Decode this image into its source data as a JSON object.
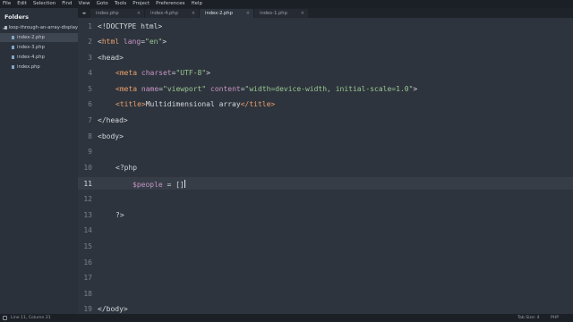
{
  "menubar": {
    "items": [
      "File",
      "Edit",
      "Selection",
      "Find",
      "View",
      "Goto",
      "Tools",
      "Project",
      "Preferences",
      "Help"
    ]
  },
  "sidebar": {
    "title": "Folders",
    "folder": "loop-through-an-array-display",
    "files": [
      {
        "name": "index-2.php",
        "active": true
      },
      {
        "name": "index-3.php",
        "active": false
      },
      {
        "name": "index-4.php",
        "active": false
      },
      {
        "name": "index.php",
        "active": false
      }
    ]
  },
  "tabs": [
    {
      "label": "index.php",
      "active": false
    },
    {
      "label": "index-4.php",
      "active": false
    },
    {
      "label": "index-2.php",
      "active": true
    },
    {
      "label": "index-1.php",
      "active": false
    }
  ],
  "editor": {
    "current_line": 11,
    "line_numbers": [
      "1",
      "2",
      "3",
      "4",
      "5",
      "6",
      "7",
      "8",
      "9",
      "10",
      "11",
      "12",
      "13",
      "14",
      "15",
      "16",
      "17",
      "18",
      "19"
    ],
    "lines": {
      "l1": "<!DOCTYPE html>",
      "l2_open": "<",
      "l2_tag": "html",
      "l2_attr": " lang",
      "l2_eq": "=",
      "l2_val": "\"en\"",
      "l2_close": ">",
      "l3": "<head>",
      "l4_tag": "<meta",
      "l4_attr": " charset",
      "l4_eq": "=",
      "l4_val": "\"UTF-8\"",
      "l4_close": ">",
      "l5_tag": "<meta",
      "l5_attr1": " name",
      "l5_eq1": "=",
      "l5_val1": "\"viewport\"",
      "l5_attr2": " content",
      "l5_eq2": "=",
      "l5_val2": "\"width=device-width, initial-scale=1.0\"",
      "l5_close": ">",
      "l6_open": "<title>",
      "l6_text": "Multidimensional array",
      "l6_close": "</title>",
      "l7": "</head>",
      "l8": "<body>",
      "l10": "<?php",
      "l11_var": "$people",
      "l11_rest": " = []",
      "l13": "?>",
      "l19": "</body>"
    }
  },
  "status": {
    "position": "Line 11, Column 21",
    "tab_size": "Tab Size: 4",
    "syntax": "PHP"
  }
}
